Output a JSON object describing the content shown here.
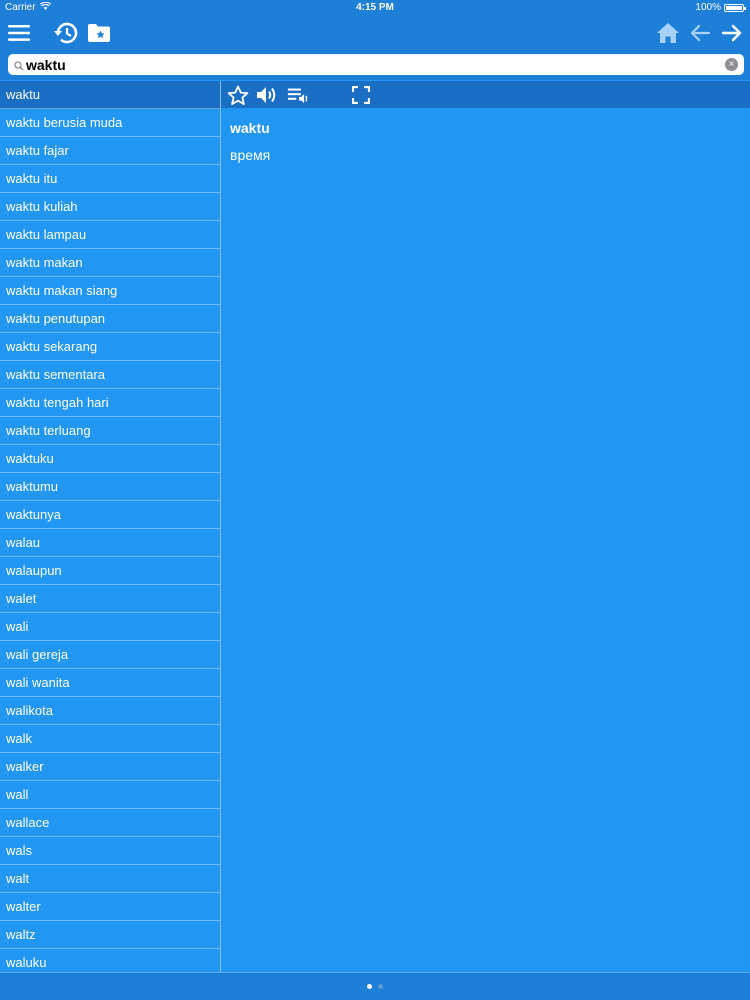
{
  "status_bar": {
    "carrier": "Carrier",
    "time": "4:15 PM",
    "battery": "100%"
  },
  "toolbar": {
    "icons": [
      "menu-icon",
      "history-icon",
      "favorites-folder-icon",
      "home-icon",
      "back-arrow-icon",
      "forward-arrow-icon"
    ]
  },
  "search": {
    "value": "waktu"
  },
  "word_list": {
    "selected_index": 0,
    "items": [
      "waktu",
      "waktu berusia muda",
      "waktu fajar",
      "waktu itu",
      "waktu kuliah",
      "waktu lampau",
      "waktu makan",
      "waktu makan siang",
      "waktu penutupan",
      "waktu sekarang",
      "waktu sementara",
      "waktu tengah hari",
      "waktu terluang",
      "waktuku",
      "waktumu",
      "waktunya",
      "walau",
      "walaupun",
      "walet",
      "wali",
      "wali gereja",
      "wali wanita",
      "walikota",
      "walk",
      "walker",
      "wall",
      "wallace",
      "wals",
      "walt",
      "walter",
      "waltz",
      "waluku"
    ]
  },
  "detail": {
    "headword": "waktu",
    "translation": "время",
    "toolbar_icons": [
      "star-icon",
      "speaker-icon",
      "playlist-audio-icon",
      "fullscreen-icon"
    ]
  },
  "pager": {
    "pages": 2,
    "current": 1
  },
  "colors": {
    "background": "#2196f3",
    "bar": "#1e7fd8",
    "selected": "#1a6fc4"
  }
}
